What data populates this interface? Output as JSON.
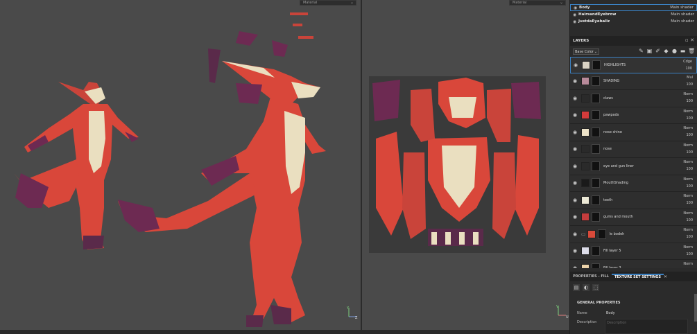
{
  "viewport3d": {
    "material_label": "Material"
  },
  "viewport2d": {
    "material_label": "Material"
  },
  "axis": {
    "y": "Y",
    "z": "Z",
    "u": "U",
    "v": "V"
  },
  "texture_sets": [
    {
      "name": "Body",
      "shader": "Main shader",
      "selected": true
    },
    {
      "name": "HairsandEyebrow",
      "shader": "Main shader",
      "selected": false
    },
    {
      "name": "JustdaEyeballz",
      "shader": "Main shader",
      "selected": false
    }
  ],
  "layers_panel": {
    "title": "LAYERS",
    "channel": "Base Color",
    "layers": [
      {
        "name": "HIGHLIGHTS",
        "blend": "Cdge",
        "opacity": "100",
        "thumb": "#d9d2c4",
        "selected": true,
        "folder": false
      },
      {
        "name": "SHADING",
        "blend": "Mul",
        "opacity": "100",
        "thumb": "#b88a9a",
        "selected": false,
        "folder": false
      },
      {
        "name": "claws",
        "blend": "Norm",
        "opacity": "100",
        "thumb": "#2a2a2a",
        "selected": false,
        "folder": false
      },
      {
        "name": "pawpads",
        "blend": "Norm",
        "opacity": "100",
        "thumb": "#d43b3b",
        "selected": false,
        "folder": false
      },
      {
        "name": "nose shine",
        "blend": "Norm",
        "opacity": "100",
        "thumb": "#ede3c8",
        "selected": false,
        "folder": false
      },
      {
        "name": "nose",
        "blend": "Norm",
        "opacity": "100",
        "thumb": "#2a2a2a",
        "selected": false,
        "folder": false
      },
      {
        "name": "eye and gun liner",
        "blend": "Norm",
        "opacity": "100",
        "thumb": "#2a2a2a",
        "selected": false,
        "folder": false
      },
      {
        "name": "MouthShading",
        "blend": "Norm",
        "opacity": "100",
        "thumb": "#1a1a1a",
        "selected": false,
        "folder": false
      },
      {
        "name": "teeth",
        "blend": "Norm",
        "opacity": "100",
        "thumb": "#ece9d6",
        "selected": false,
        "folder": false
      },
      {
        "name": "gums and mouth",
        "blend": "Norm",
        "opacity": "100",
        "thumb": "#c43d3d",
        "selected": false,
        "folder": false
      },
      {
        "name": "le bodeh",
        "blend": "Norm",
        "opacity": "100",
        "thumb": "#d94a3a",
        "selected": false,
        "folder": true
      },
      {
        "name": "Fill layer 5",
        "blend": "Norm",
        "opacity": "100",
        "thumb": "#dcdce8",
        "selected": false,
        "folder": false
      },
      {
        "name": "Fill layer 3",
        "blend": "Norm",
        "opacity": "100",
        "thumb": "#ecd3aa",
        "selected": false,
        "folder": false
      }
    ]
  },
  "properties": {
    "tab_fill": "PROPERTIES - FILL",
    "tab_texset": "TEXTURE SET SETTINGS",
    "section": "GENERAL PROPERTIES",
    "name_label": "Name",
    "name_value": "Body",
    "desc_label": "Description",
    "desc_placeholder": "Description"
  },
  "colors": {
    "accent": "#3b82c4",
    "body_red": "#d9473a",
    "belly_cream": "#eadfc0",
    "purple": "#5a2a4a"
  }
}
